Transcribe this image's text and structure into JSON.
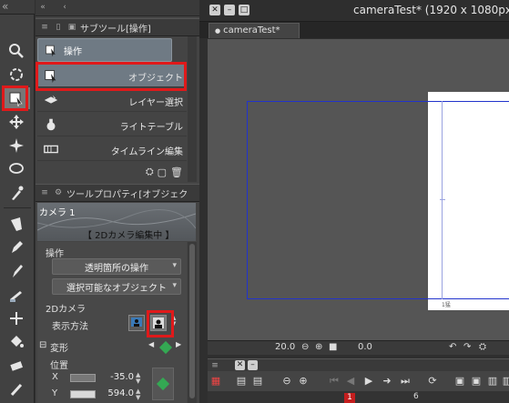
{
  "window": {
    "title": "cameraTest* (1920 x 1080px",
    "doc_tab": "cameraTest*"
  },
  "tools_header": "«",
  "subtool_panel": {
    "title": "サブツール[操作]",
    "group_tab": "操作",
    "items": [
      {
        "label": "オブジェクト",
        "icon": "object-select-icon",
        "selected": true
      },
      {
        "label": "レイヤー選択",
        "icon": "layer-select-icon",
        "selected": false
      },
      {
        "label": "ライトテーブル",
        "icon": "light-table-icon",
        "selected": false
      },
      {
        "label": "タイムライン編集",
        "icon": "timeline-edit-icon",
        "selected": false
      }
    ]
  },
  "property_panel": {
    "title": "ツールプロパティ[オブジェク",
    "camera_name": "カメラ 1",
    "mode_banner": "【 2Dカメラ編集中 】",
    "section_operation": "操作",
    "dropdown_transparent": "透明箇所の操作",
    "dropdown_selectable": "選択可能なオブジェクト",
    "section_2d_camera": "2Dカメラ",
    "display_method_label": "表示方法",
    "transform_label": "変形",
    "position_label": "位置",
    "x_label": "X",
    "x_value": "-35.0",
    "y_label": "Y",
    "y_value": "594.0"
  },
  "canvas": {
    "zoom": "20.0",
    "rotation": "0.0",
    "camera_label": "1猛"
  },
  "timeline": {
    "current_frame": "1",
    "ruler_mark": "6"
  },
  "colors": {
    "highlight": "#e0191a",
    "camera_frame": "#2233cc",
    "keyframe": "#34a853",
    "selected_item": "#6f7a84"
  }
}
